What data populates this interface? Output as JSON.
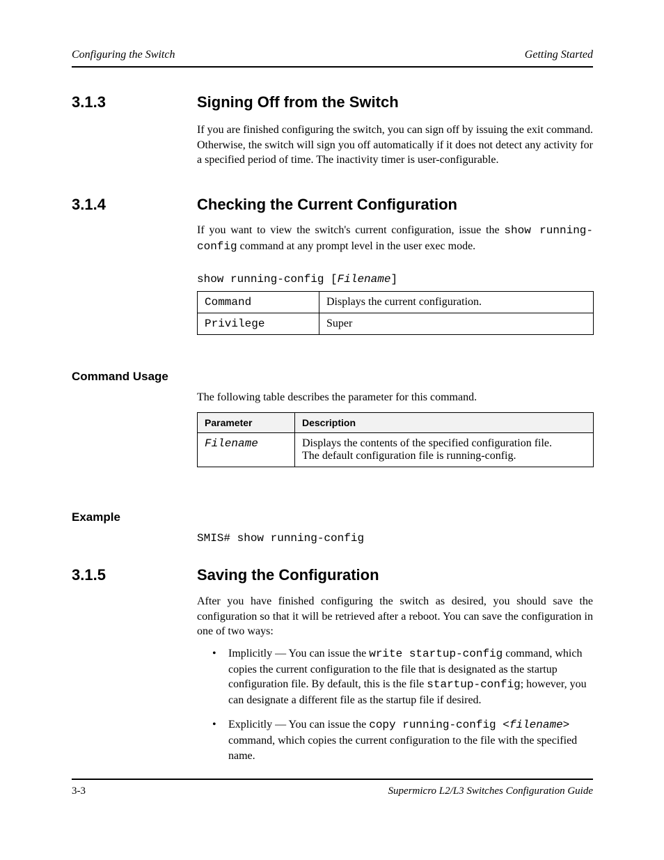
{
  "header": {
    "left": "Configuring the Switch",
    "right": "Getting Started"
  },
  "sec1": {
    "num": "3.1.3",
    "title": "Signing Off from the Switch"
  },
  "para1": "If you are finished configuring the switch, you can sign off by issuing the exit command. Otherwise, the switch will sign you off automatically if it does not detect any activity for a specified period of time. The inactivity timer is user-configurable.",
  "sec2": {
    "num": "3.1.4",
    "title": "Checking the Current Configuration"
  },
  "para2_prefix": "If you want to view the switch's current configuration, issue the ",
  "para2_cmd": "show running-config",
  "para2_suffix": " command at any prompt level in the user exec mode.",
  "table1": {
    "r1c1": "Command",
    "r1c2": "Displays the current configuration.",
    "r2c1": "Privilege",
    "r2c2": "Super"
  },
  "sub1": {
    "title": "Command Usage"
  },
  "table2": {
    "hdr1": "Parameter",
    "hdr2": "Description",
    "row1c1": "Filename",
    "row1c2_line1": "Displays the contents of the specified configuration file.",
    "row1c2_line2": "The default configuration file is running-config."
  },
  "sub2": {
    "title": "Example"
  },
  "example_text": "SMIS# show running-config",
  "sec3": {
    "num": "3.1.5",
    "title": "Saving the Configuration"
  },
  "para3": "After you have finished configuring the switch as desired, you should save the configuration so that it will be retrieved after a reboot. You can save the configuration in one of two ways:",
  "bullets": [
    "Implicitly — You can issue the write startup-config command, which copies the current configuration to the file that is designated as the startup configuration file. By default, this is the file startup-config; however, you can designate a different file as the startup file if desired.",
    "Explicitly — You can issue the copy running-config <filename> command, which copies the current configuration to the file with the specified name."
  ],
  "footer": {
    "left": "3-3",
    "right": "Supermicro L2/L3 Switches Configuration Guide"
  }
}
